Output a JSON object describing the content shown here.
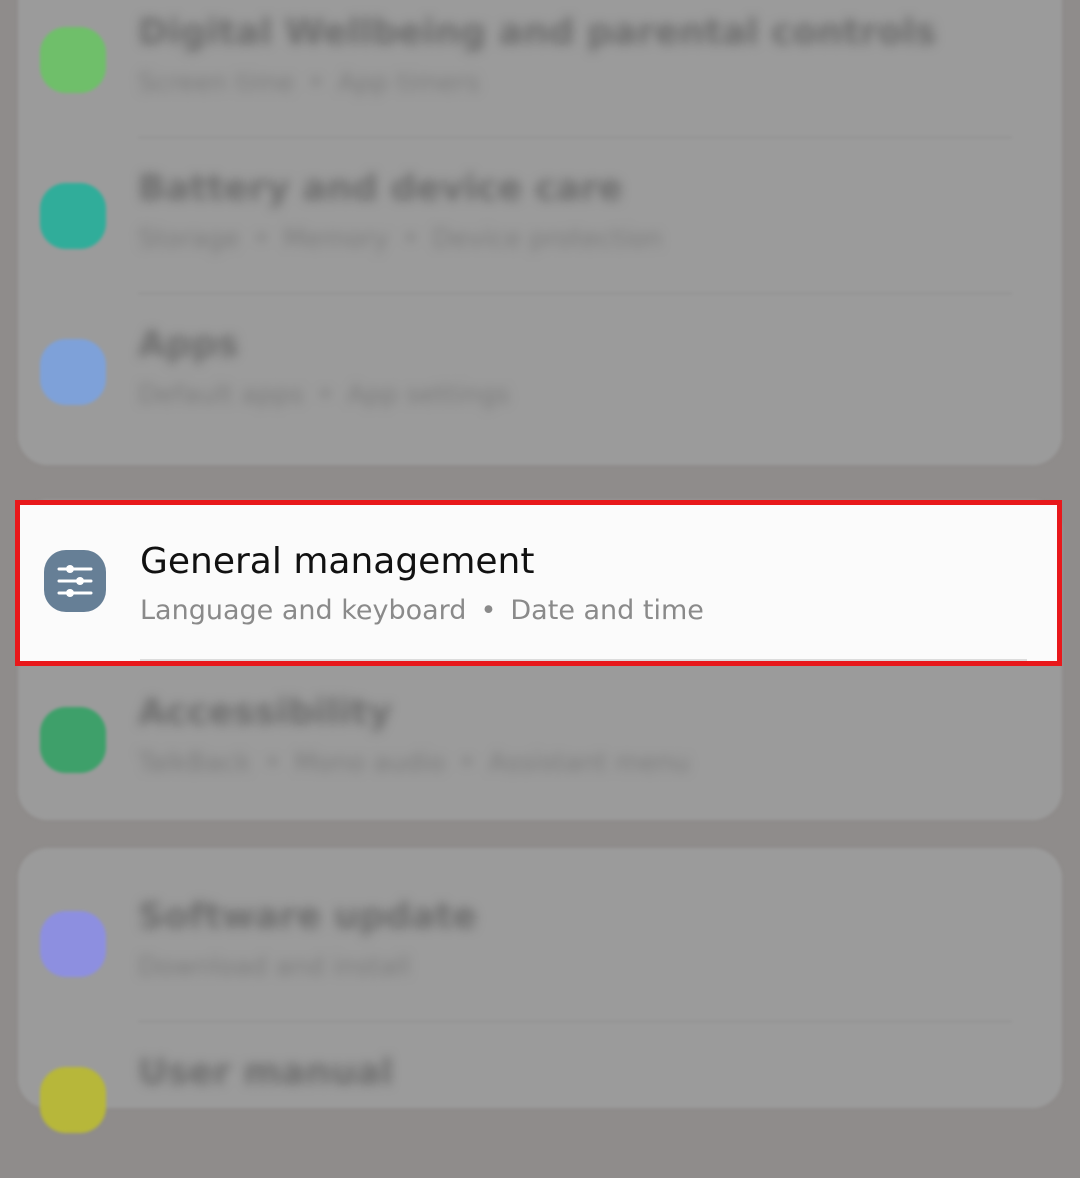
{
  "settings": {
    "items": [
      {
        "title": "Digital Wellbeing and parental controls",
        "sub_a": "Screen time",
        "sub_b": "App timers",
        "color": "#6fbf6a"
      },
      {
        "title": "Battery and device care",
        "sub_a": "Storage",
        "sub_b": "Memory",
        "sub_c": "Device protection",
        "color": "#30ad9a"
      },
      {
        "title": "Apps",
        "sub_a": "Default apps",
        "sub_b": "App settings",
        "color": "#7ea1d9"
      },
      {
        "title": "Accessibility",
        "sub_a": "TalkBack",
        "sub_b": "Mono audio",
        "sub_c": "Assistant menu",
        "color": "#3ea06a"
      },
      {
        "title": "Software update",
        "sub_a": "Download and install",
        "color": "#8d8fe0"
      },
      {
        "title": "User manual",
        "color": "#b7b73a"
      }
    ],
    "highlighted": {
      "title": "General management",
      "sub_a": "Language and keyboard",
      "sub_b": "Date and time",
      "icon": "sliders-icon",
      "icon_color": "#667f96",
      "highlight_color": "#e8181b"
    },
    "separator": "•"
  }
}
